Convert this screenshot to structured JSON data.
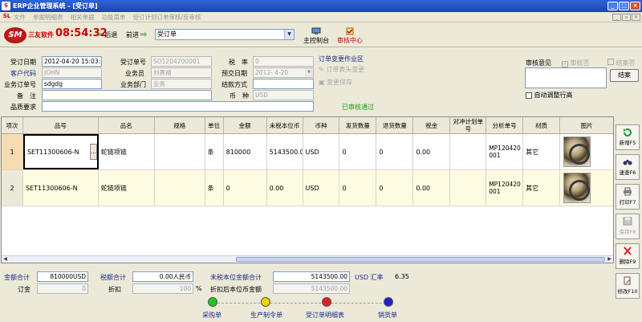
{
  "window": {
    "title": "ERP企业管理系统 - [受订单]"
  },
  "menu": {
    "items": [
      "文件",
      "单据明细表",
      "相关单据",
      "功能菜单",
      "受订计划订单审核/反审核"
    ]
  },
  "toolbar": {
    "brand": "三友软件",
    "clock": "08:54:32",
    "back": "后退",
    "forward": "前进",
    "doc_combo": "受订单",
    "main_console": "主控制台",
    "audit_center": "审核中心"
  },
  "form": {
    "order_date_label": "受订日期",
    "order_date": "2012-04-20 15:03:35",
    "order_no_label": "受订单号",
    "order_no": "SO1204200001",
    "tax_rate_label": "税　率",
    "tax_rate": "0",
    "customer_code_label": "客户代码",
    "customer_code": "JOHN",
    "salesman_label": "业务员",
    "salesman": "刘勇福",
    "pre_delivery_label": "预交日期",
    "pre_delivery": "2012- 4-20",
    "business_order_label": "业务订单号",
    "business_order": "sdgdg",
    "dept_label": "业务部门",
    "dept": "业务",
    "settle_label": "结款方式",
    "settle": "",
    "remark_label": "备　注",
    "remark": "",
    "currency_label": "币　种",
    "currency": "USD",
    "quality_label": "品质要求",
    "quality": "",
    "change_area_label": "订单变更作业区",
    "change_header": "订单表头变更",
    "change_save": "变更保存",
    "audited_status": "已审核通过"
  },
  "audit": {
    "opinion_label": "审核意见",
    "audit_no": "审核否",
    "case_close": "结案否",
    "case_btn": "结案",
    "auto_adjust": "自动调整行高"
  },
  "grid": {
    "headers": [
      "项次",
      "品号",
      "品名",
      "规格",
      "单位",
      "金额",
      "未税本位币",
      "币种",
      "发货数量",
      "退货数量",
      "税金",
      "对冲计划单号",
      "分析单号",
      "材质",
      "图片"
    ],
    "rows": [
      {
        "idx": "1",
        "code": "SET11300606-N",
        "name": "蛇链项链",
        "spec": "",
        "unit": "条",
        "amount": "810000",
        "untaxed": "5143500.00",
        "currency": "USD",
        "ship_qty": "0",
        "return_qty": "0",
        "tax": "0.00",
        "hedge": "",
        "analysis": "MP120420001",
        "material": "其它"
      },
      {
        "idx": "2",
        "code": "SET11300606-N",
        "name": "蛇链项链",
        "spec": "",
        "unit": "条",
        "amount": "0",
        "untaxed": "0.00",
        "currency": "USD",
        "ship_qty": "0",
        "return_qty": "0",
        "tax": "0.00",
        "hedge": "",
        "analysis": "MP120420001",
        "material": "其它"
      }
    ]
  },
  "side": {
    "add": "新增F5",
    "query": "速查F6",
    "print": "打印F7",
    "save": "保存F8",
    "delete": "删除F9",
    "modify": "修改F10"
  },
  "totals": {
    "amount_label": "金额合计",
    "amount": "810000USD",
    "rmb_label": "税额合计",
    "rmb": "0.00人民币",
    "untaxed_label": "未税本位金额合计",
    "untaxed": "5143500.00",
    "currency_rate_label": "USD 汇率",
    "rate": "6.35",
    "deposit_label": "订金",
    "deposit": "0",
    "discount_label": "折扣",
    "discount": "100",
    "percent": "%",
    "after_discount_label": "折扣后本位币金额",
    "after_discount": "5143500.00"
  },
  "flow": {
    "purchase": "采购单",
    "production": "生产制令单",
    "order_detail": "受订单明细表",
    "sales": "销货单",
    "colors": {
      "purchase": "#22c422",
      "production": "#f0d000",
      "order_detail": "#e02020",
      "sales": "#2020d0"
    }
  }
}
